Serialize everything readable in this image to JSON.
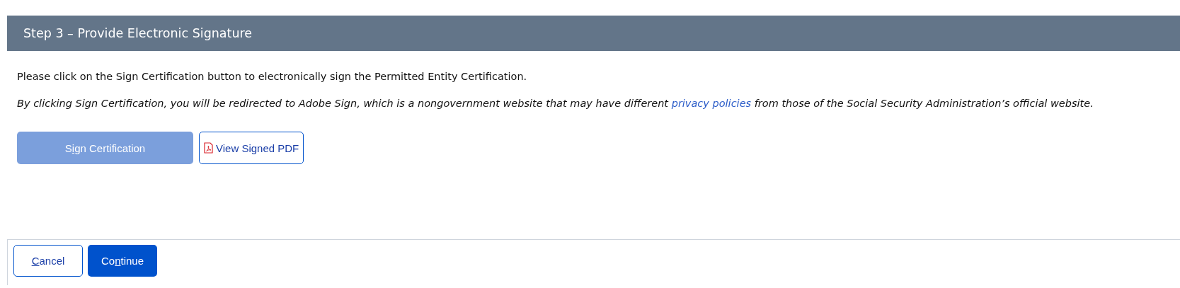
{
  "header": {
    "title": "Step 3 – Provide Electronic Signature"
  },
  "instruction": "Please click on the Sign Certification button to electronically sign the Permitted Entity Certification.",
  "notice": {
    "before": "By clicking Sign Certification, you will be redirected to Adobe Sign, which is a nongovernment website that may have different ",
    "link": "privacy policies",
    "after": " from those of the Social Security Administration’s official website."
  },
  "actions": [
    {
      "kind": "primary",
      "before": "S",
      "key": "i",
      "after": "gn Certification",
      "disabled": true
    },
    {
      "kind": "pdf",
      "after": "View Signed PDF",
      "disabled": false
    }
  ],
  "footer_buttons": [
    {
      "kind": "secondary",
      "key": "C",
      "after": "ancel",
      "disabled": false
    },
    {
      "kind": "primary",
      "before": "Co",
      "key": "n",
      "after": "tinue",
      "disabled": false
    }
  ]
}
